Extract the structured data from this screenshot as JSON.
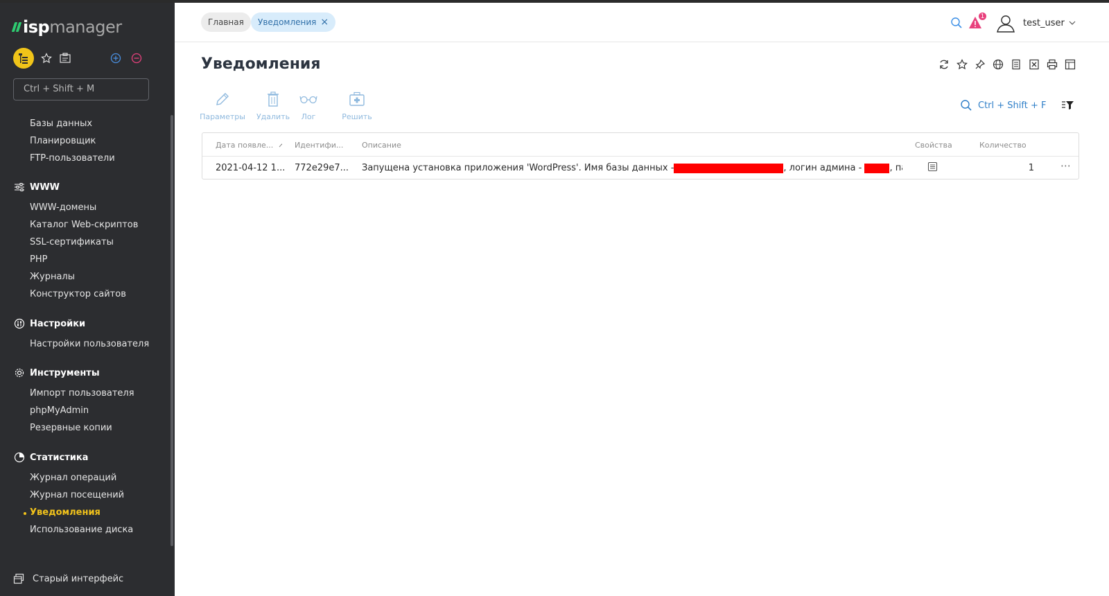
{
  "app": {
    "logo_part1": "isp",
    "logo_part2": "manager"
  },
  "sidebar": {
    "search_placeholder": "Ctrl + Shift + M",
    "items_top": [
      "Базы данных",
      "Планировщик",
      "FTP-пользователи"
    ],
    "groups": [
      {
        "title": "WWW",
        "icon": "sliders-icon",
        "items": [
          "WWW-домены",
          "Каталог Web-скриптов",
          "SSL-сертификаты",
          "PHP",
          "Журналы",
          "Конструктор сайтов"
        ]
      },
      {
        "title": "Настройки",
        "icon": "settings-circle-icon",
        "items": [
          "Настройки пользователя"
        ]
      },
      {
        "title": "Инструменты",
        "icon": "gear-icon",
        "items": [
          "Импорт пользователя",
          "phpMyAdmin",
          "Резервные копии"
        ]
      },
      {
        "title": "Статистика",
        "icon": "pie-chart-icon",
        "items": [
          "Журнал операций",
          "Журнал посещений",
          "Уведомления",
          "Использование диска"
        ]
      }
    ],
    "active_item": "Уведомления",
    "old_interface": "Старый интерфейс"
  },
  "topbar": {
    "breadcrumbs": [
      "Главная",
      "Уведомления"
    ],
    "alert_count": "1",
    "username": "test_user"
  },
  "page": {
    "title": "Уведомления",
    "actions": [
      "Параметры",
      "Удалить",
      "Лог",
      "Решить"
    ],
    "table_search": "Ctrl + Shift + F"
  },
  "table": {
    "headers": [
      "Дата появле...",
      "Идентифи...",
      "Описание",
      "Свойства",
      "Количество"
    ],
    "rows": [
      {
        "date": "2021-04-12 1...",
        "id": "772e29e7...",
        "desc_a": "Запущена установка приложения 'WordPress'. Имя базы данных -",
        "desc_b": ", логин админа -",
        "desc_c": ", пароль ...",
        "count": "1"
      }
    ]
  },
  "colors": {
    "sidebar_bg": "#2c2d30",
    "accent_yellow": "#f2c31b",
    "link_blue": "#2f7fc8",
    "alert_pink": "#e8417d"
  }
}
